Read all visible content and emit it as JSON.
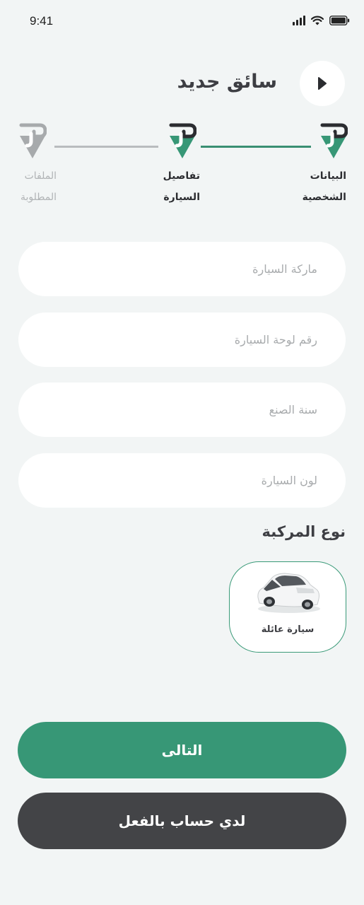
{
  "status_bar": {
    "time": "9:41"
  },
  "header": {
    "title": "سائق جديد"
  },
  "stepper": {
    "steps": [
      {
        "line1": "البيانات",
        "line2": "الشخصية",
        "state": "active"
      },
      {
        "line1": "تفاصيل",
        "line2": "السيارة",
        "state": "active"
      },
      {
        "line1": "الملفات",
        "line2": "المطلوبة",
        "state": "inactive"
      }
    ]
  },
  "form": {
    "car_brand": {
      "value": "",
      "placeholder": "ماركة السيارة"
    },
    "plate_number": {
      "value": "",
      "placeholder": "رقم لوحة السيارة"
    },
    "manufacture_year": {
      "value": "",
      "placeholder": "سنة الصنع"
    },
    "car_color": {
      "value": "",
      "placeholder": "لون السيارة"
    }
  },
  "vehicle_type": {
    "title": "نوع المركبة",
    "options": [
      {
        "label": "سيارة عائلة",
        "selected": true
      }
    ]
  },
  "buttons": {
    "next_label": "التالى",
    "login_label": "لدي حساب بالفعل"
  },
  "colors": {
    "accent": "#379776",
    "dark": "#434447",
    "inactive": "#b0b3b5",
    "background": "#f2f5f5"
  }
}
